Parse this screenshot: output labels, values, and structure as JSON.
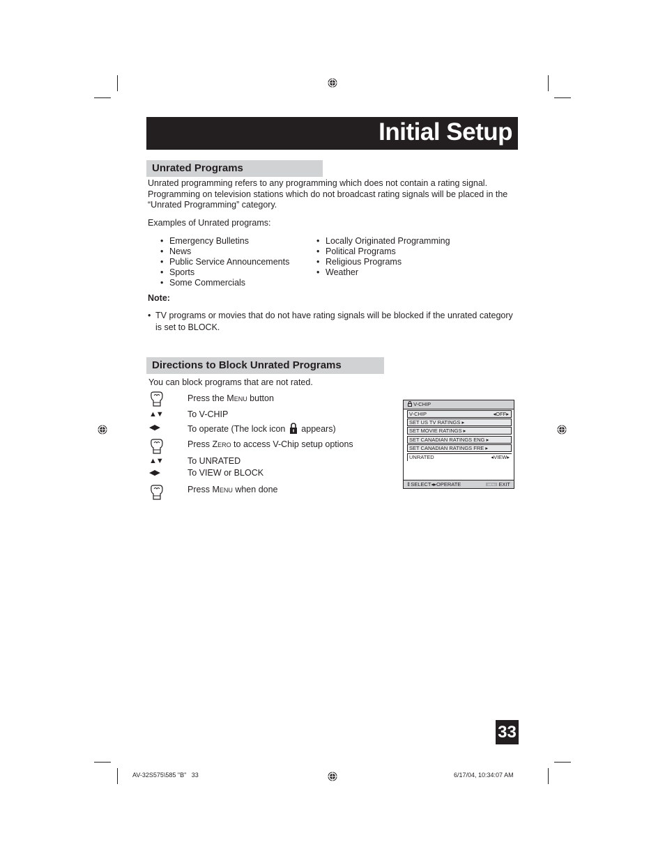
{
  "header": {
    "title": "Initial Setup"
  },
  "unrated_section": {
    "heading": "Unrated Programs",
    "intro_lines": [
      "Unrated programming refers to any programming which does not contain a rating signal.",
      "Programming on television stations which do not broadcast rating signals will be placed in the",
      "“Unrated Programming” category."
    ],
    "examples_label": "Examples of Unrated programs:",
    "examples_left": [
      "Emergency Bulletins",
      "News",
      "Public Service Announcements",
      "Sports",
      "Some Commercials"
    ],
    "examples_right": [
      "Locally Originated Programming",
      "Political Programs",
      "Religious Programs",
      "Weather"
    ],
    "note_label": "Note:",
    "note_lines": [
      "TV programs or movies that do not have rating signals will be blocked if the unrated category",
      "is set to BLOCK."
    ]
  },
  "directions_section": {
    "heading": "Directions to Block Unrated Programs",
    "intro": "You can block programs that are not rated.",
    "steps": [
      {
        "icon": "hand-press-icon",
        "pre": "Press the ",
        "sc": "Menu",
        "post": " button"
      },
      {
        "icon": "up-down-arrows-icon",
        "text": "To V-CHIP"
      },
      {
        "icon": "left-right-arrows-icon",
        "pre": "To operate (The lock icon ",
        "post": " appears)"
      },
      {
        "icon": "hand-press-icon",
        "pre": "Press ",
        "sc": "Zero",
        "post": " to access V-Chip setup options"
      },
      {
        "icon": "up-down-arrows-icon",
        "text": "To UNRATED"
      },
      {
        "icon": "left-right-arrows-icon",
        "text": "To VIEW or BLOCK"
      },
      {
        "icon": "hand-press-icon",
        "pre": "Press ",
        "sc": "Menu",
        "post": " when done"
      }
    ]
  },
  "osd": {
    "title": "V-CHIP",
    "rows": [
      {
        "label": "V-CHIP",
        "value": "OFF"
      },
      {
        "label": "SET US TV RATINGS"
      },
      {
        "label": "SET MOVIE RATINGS"
      },
      {
        "label": "SET CANADIAN RATINGS ENG"
      },
      {
        "label": "SET CANADIAN RATINGS FRE"
      },
      {
        "label": "UNRATED",
        "value": "VIEW"
      }
    ],
    "footer": {
      "select": "SELECT",
      "operate": "OPERATE",
      "menu_badge": "MENU",
      "exit": "EXIT"
    }
  },
  "page_number": "33",
  "print_footer": {
    "left": "AV-32S575\\585 \"B\"   33",
    "right": "6/17/04, 10:34:07 AM"
  }
}
